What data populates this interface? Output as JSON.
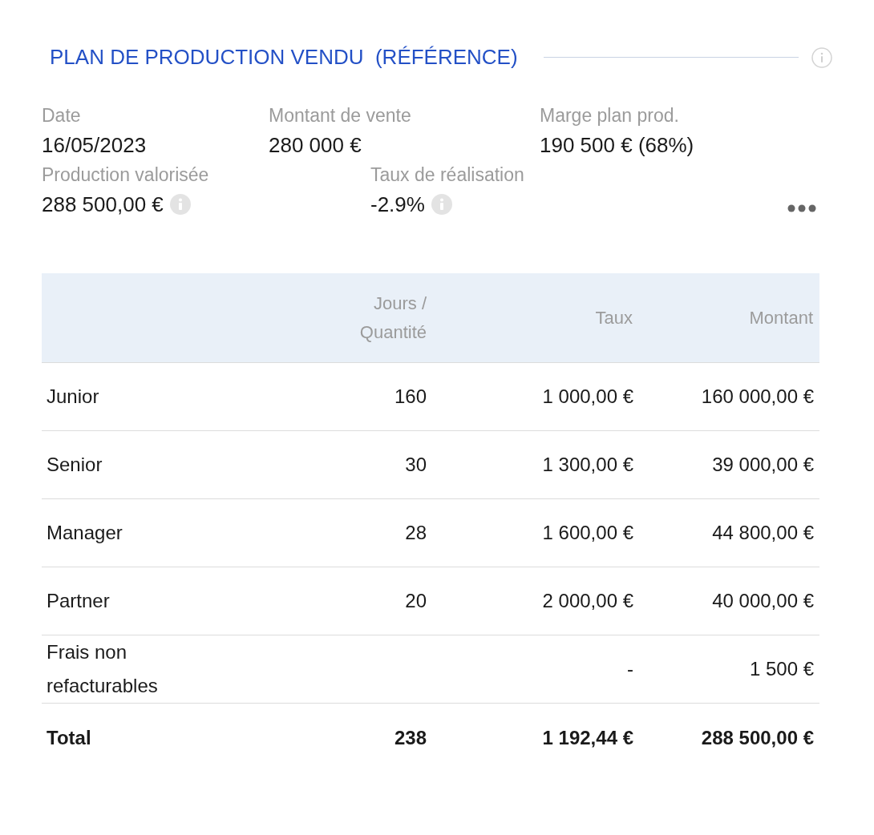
{
  "title": "PLAN DE PRODUCTION VENDU  (RÉFÉRENCE)",
  "summary": [
    [
      {
        "kind": "plain",
        "label": "Date",
        "value": "16/05/2023"
      },
      {
        "kind": "plain",
        "label": "Montant de vente",
        "value": "280 000 €"
      },
      {
        "kind": "plain",
        "label": "Marge plan prod.",
        "value": "190 500 € (68%)"
      }
    ],
    [
      {
        "kind": "info",
        "label": "Production valorisée",
        "value": "288 500,00 €"
      },
      {
        "kind": "info",
        "label": "Taux de réalisation",
        "value": "-2.9%"
      }
    ]
  ],
  "table": {
    "columns": [
      "Jours / Quantité",
      "Taux",
      "Montant"
    ],
    "rows": [
      {
        "kind": "line",
        "label": "Junior",
        "quantity": "160",
        "rate": "1 000,00 €",
        "amount": "160 000,00 €"
      },
      {
        "kind": "line",
        "label": "Senior",
        "quantity": "30",
        "rate": "1 300,00 €",
        "amount": "39 000,00 €"
      },
      {
        "kind": "line",
        "label": "Manager",
        "quantity": "28",
        "rate": "1 600,00 €",
        "amount": "44 800,00 €"
      },
      {
        "kind": "line",
        "label": "Partner",
        "quantity": "20",
        "rate": "2 000,00 €",
        "amount": "40 000,00 €"
      },
      {
        "kind": "line",
        "label": "Frais non refacturables",
        "rate": "-",
        "amount": "1 500 €"
      },
      {
        "kind": "total",
        "label": "Total",
        "quantity": "238",
        "rate": "1 192,44 €",
        "amount": "288 500,00 €"
      }
    ]
  }
}
